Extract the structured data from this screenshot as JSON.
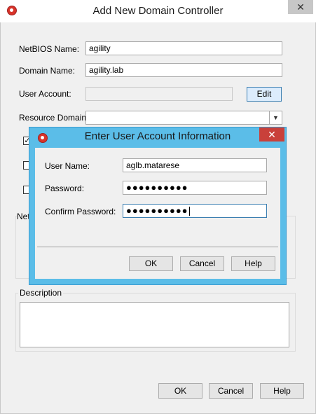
{
  "window": {
    "title": "Add New Domain Controller",
    "close_glyph": "✕",
    "icon": "app-logo-icon"
  },
  "form": {
    "netbios_label": "NetBIOS Name:",
    "netbios_value": "agility",
    "domain_label": "Domain Name:",
    "domain_value": "agility.lab",
    "user_account_label": "User Account:",
    "user_account_value": "",
    "edit_label": "Edit",
    "resource_domain_label": "Resource Domain",
    "resource_domain_value": "",
    "dropdown_glyph": "▼",
    "checkbox_1_checked": "✓",
    "net_group_label_partial": "Net",
    "description_label": "Description",
    "description_value": ""
  },
  "footer": {
    "ok_label": "OK",
    "cancel_label": "Cancel",
    "help_label": "Help"
  },
  "dialog": {
    "title": "Enter User Account Information",
    "close_glyph": "✕",
    "icon": "app-logo-icon",
    "username_label": "User Name:",
    "username_value": "aglb.matarese",
    "password_label": "Password:",
    "password_value": "●●●●●●●●●●",
    "confirm_label": "Confirm Password:",
    "confirm_value": "●●●●●●●●●●",
    "ok_label": "OK",
    "cancel_label": "Cancel",
    "help_label": "Help"
  },
  "colors": {
    "dialog_frame": "#5bbde8",
    "dialog_close": "#c9403a",
    "edit_button_bg": "#dcecfc"
  }
}
